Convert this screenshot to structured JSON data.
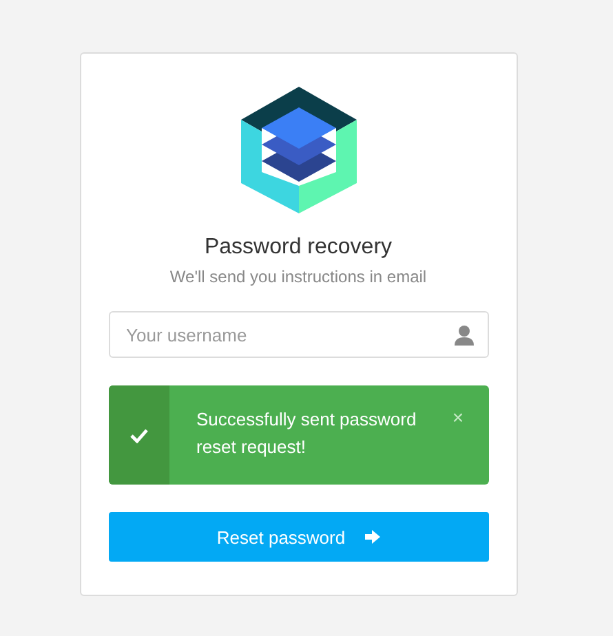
{
  "title": "Password recovery",
  "subtitle": "We'll send you instructions in email",
  "username_field": {
    "placeholder": "Your username"
  },
  "alert": {
    "kind": "success",
    "message": "Successfully sent password reset request!",
    "close": "×"
  },
  "submit_button": {
    "label": "Reset password"
  }
}
